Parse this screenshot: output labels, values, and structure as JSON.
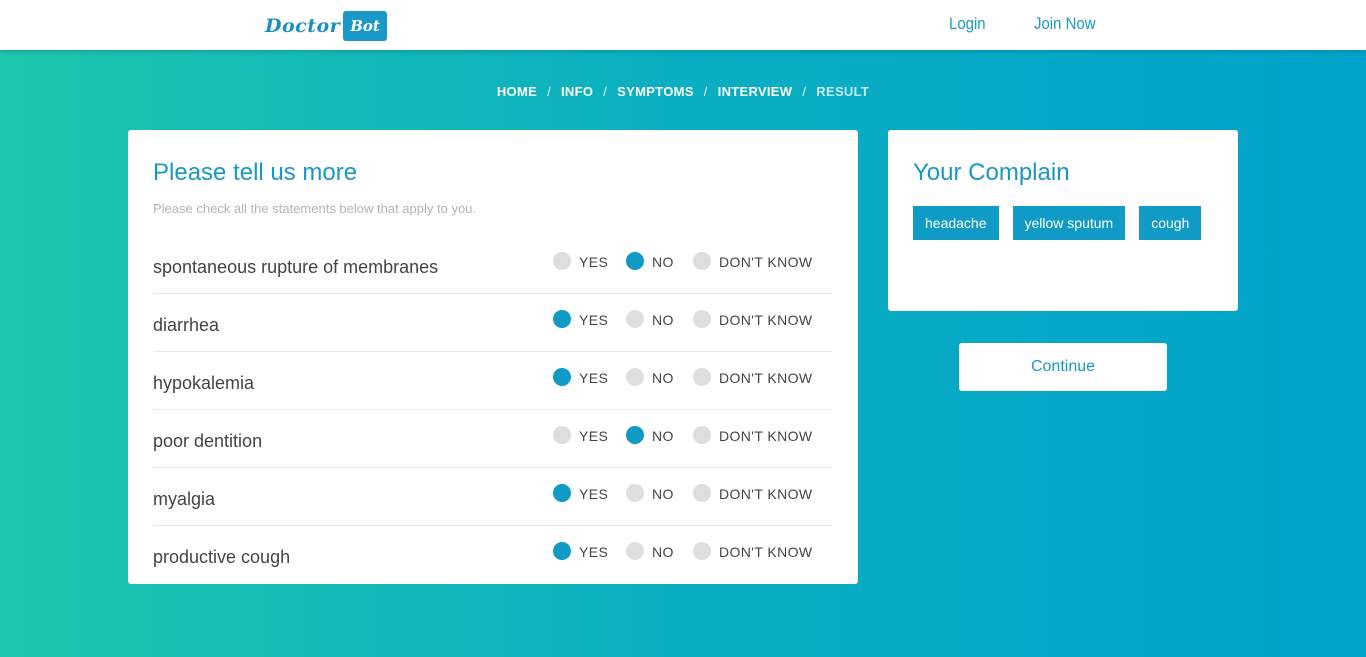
{
  "brand": {
    "name_part1": "Doctor",
    "name_part2": "Bot"
  },
  "nav": {
    "login": "Login",
    "join": "Join Now"
  },
  "breadcrumb": [
    {
      "label": "HOME",
      "active": false
    },
    {
      "label": "INFO",
      "active": false
    },
    {
      "label": "SYMPTOMS",
      "active": false
    },
    {
      "label": "INTERVIEW",
      "active": false
    },
    {
      "label": "RESULT",
      "active": true
    }
  ],
  "breadcrumb_separator": "/",
  "interview": {
    "title": "Please tell us more",
    "subtitle": "Please check all the statements below that apply to you.",
    "option_labels": {
      "yes": "YES",
      "no": "NO",
      "dont_know": "DON'T KNOW"
    },
    "questions": [
      {
        "text": "spontaneous rupture of membranes",
        "answer": "no"
      },
      {
        "text": "diarrhea",
        "answer": "yes"
      },
      {
        "text": "hypokalemia",
        "answer": "yes"
      },
      {
        "text": "poor dentition",
        "answer": "no"
      },
      {
        "text": "myalgia",
        "answer": "yes"
      },
      {
        "text": "productive cough",
        "answer": "yes"
      }
    ]
  },
  "complain": {
    "title": "Your Complain",
    "tags": [
      "headache",
      "yellow sputum",
      "cough"
    ]
  },
  "continue_label": "Continue",
  "colors": {
    "accent": "#0f9bc6",
    "gradient_start": "#1cc6ac",
    "gradient_end": "#00a3c9"
  }
}
